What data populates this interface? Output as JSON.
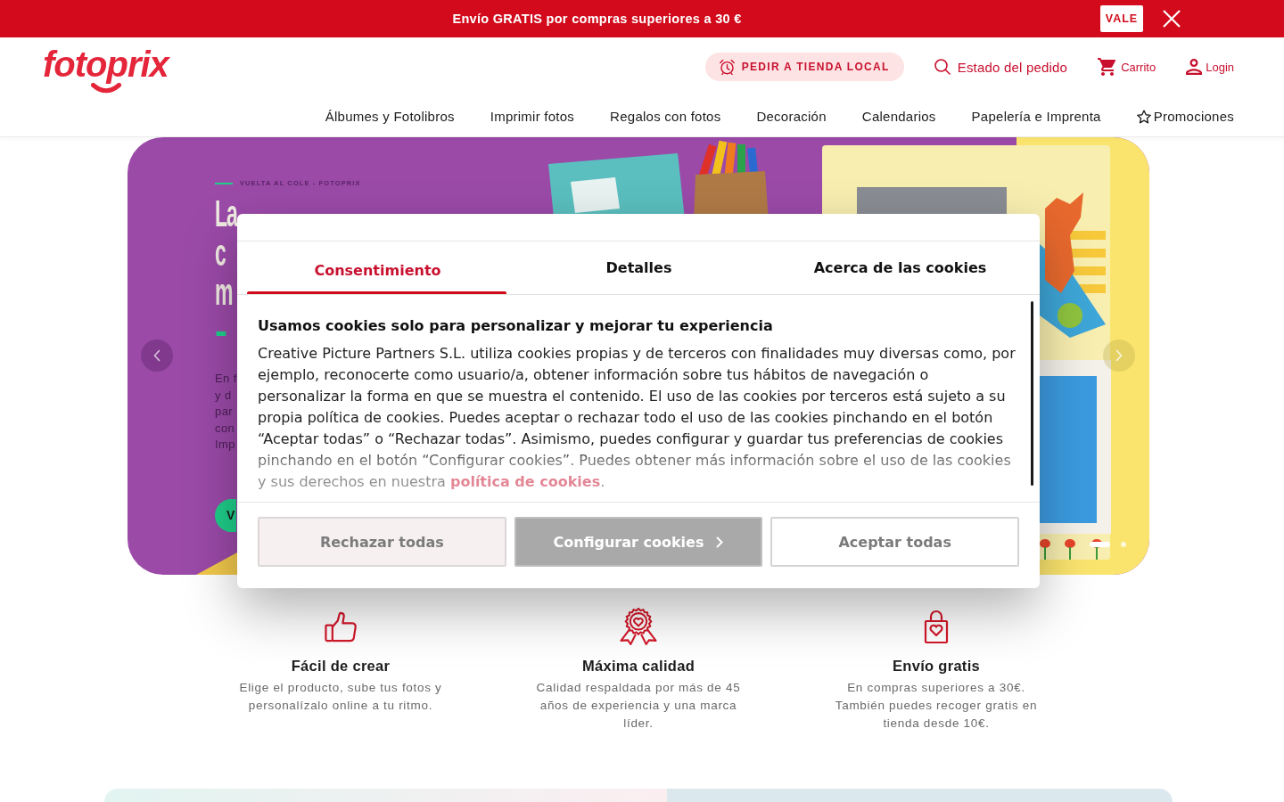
{
  "promo_bar": {
    "text": "Envío GRATIS por compras superiores a 30 €",
    "button": "VALE"
  },
  "header": {
    "logo": "fotoprix",
    "store_button": "PEDIR A TIENDA LOCAL",
    "links": [
      {
        "kind": "search",
        "label": "Estado del pedido"
      },
      {
        "kind": "cart",
        "label": "Carrito"
      },
      {
        "kind": "user",
        "label": "Login"
      }
    ],
    "nav": [
      {
        "kind": "plain",
        "label": "Álbumes y Fotolibros"
      },
      {
        "kind": "plain",
        "label": "Imprimir fotos"
      },
      {
        "kind": "plain",
        "label": "Regalos con fotos"
      },
      {
        "kind": "plain",
        "label": "Decoración"
      },
      {
        "kind": "plain",
        "label": "Calendarios"
      },
      {
        "kind": "plain",
        "label": "Papelería e Imprenta"
      },
      {
        "kind": "star",
        "label": "Promociones"
      }
    ]
  },
  "hero": {
    "eyebrow": "VUELTA AL COLE - FOTOPRIX",
    "headline": [
      "La",
      "c",
      "m"
    ],
    "discount": "-",
    "body": [
      "En f",
      "y d",
      "par",
      "con",
      "Imp"
    ],
    "button": "V",
    "slide_dots": [
      {
        "selected": true
      },
      {
        "selected": false
      }
    ]
  },
  "cookie_dialog": {
    "tabs": [
      {
        "label": "Consentimiento",
        "selected": true
      },
      {
        "label": "Detalles",
        "selected": false
      },
      {
        "label": "Acerca de las cookies",
        "selected": false
      }
    ],
    "title": "Usamos cookies solo para personalizar y mejorar tu experiencia",
    "text": "Creative Picture Partners S.L. utiliza cookies propias y de terceros con finalidades muy diversas como, por ejemplo, reconocerte como usuario/a, obtener información sobre tus hábitos de navegación o personalizar la forma en que se muestra el contenido. El uso de las cookies por terceros está sujeto a su propia política de cookies. Puedes aceptar o rechazar todo el uso de las cookies pinchando en el botón “Aceptar todas” o “Rechazar todas”. Asimismo, puedes configurar y guardar tus preferencias de cookies pinchando en el botón “Configurar cookies”. Puedes obtener más información sobre el uso de las cookies y sus derechos en nuestra",
    "link": "política de cookies",
    "text_end": ".",
    "buttons": [
      {
        "kind": "reject",
        "label": "Rechazar todas"
      },
      {
        "kind": "configure",
        "label": "Configurar cookies"
      },
      {
        "kind": "accept",
        "label": "Aceptar todas"
      }
    ]
  },
  "features": [
    {
      "kind": "thumbs-up",
      "title": "Fácil de crear",
      "text": "Elige el producto, sube tus fotos y personalízalo online a tu ritmo."
    },
    {
      "kind": "award",
      "title": "Máxima calidad",
      "text": "Calidad respaldada por más de 45 años de experiencia y una marca líder."
    },
    {
      "kind": "bag",
      "title": "Envío gratis",
      "text": "En compras superiores a 30€. También puedes recoger gratis en tienda desde 10€."
    }
  ]
}
